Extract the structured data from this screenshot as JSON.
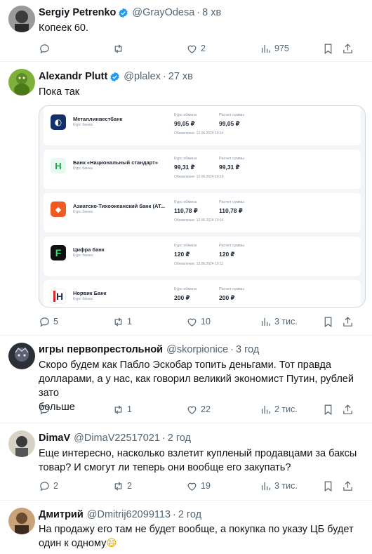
{
  "tweets": [
    {
      "name": "Sergiy Petrenko",
      "handle": "@GrayOdesa",
      "time": "8 хв",
      "text": "Копеек 60.",
      "replies": "",
      "retweets": "",
      "likes": "2",
      "views": "975"
    },
    {
      "name": "Alexandr Plutt",
      "handle": "@plalex",
      "time": "27 хв",
      "text": "Пока так",
      "replies": "5",
      "retweets": "1",
      "likes": "10",
      "views": "3 тис."
    },
    {
      "name": "игры первопрестольной",
      "handle": "@skorpionice",
      "time": "3 год",
      "text_line1": "Скоро будем как Пабло Эскобар топить деньгами. Тот правда",
      "text_line2": "долларами, а у нас, как говорил великий экономист Путин, рублей зато",
      "text_line3": "больше",
      "replies": "",
      "retweets": "1",
      "likes": "22",
      "views": "2 тис."
    },
    {
      "name": "DimaV",
      "handle": "@DimaV22517021",
      "time": "2 год",
      "text_line1": "Еще интересно, насколько взлетит купленый продавцами за баксы",
      "text_line2": "товар? И смогут ли теперь они вообще его закупать?",
      "replies": "2",
      "retweets": "2",
      "likes": "19",
      "views": "3 тис."
    },
    {
      "name": "Дмитрий",
      "handle": "@Dmitrij62099113",
      "time": "2 год",
      "text_line1": "На продажу его там не будет вообще, а покупка по указу ЦБ будет",
      "text_line2": "один к одному",
      "emoji": "😄"
    }
  ],
  "banks": [
    {
      "name": "Металлинвестбанк",
      "sub": "Курс банка",
      "l1": "Курс обмена",
      "v1": "99,05 ₽",
      "l2": "Расчет суммы",
      "v2": "99,05 ₽",
      "upd": "Обновление: 12.06.2024 19:14",
      "logo_color": "#12316b",
      "logo_char": "◐"
    },
    {
      "name": "Банк «Национальный стандарт»",
      "sub": "Курс банка",
      "l1": "Курс обмена",
      "v1": "99,31 ₽",
      "l2": "Расчет суммы",
      "v2": "99,31 ₽",
      "upd": "Обновление: 12.06.2024 19:16",
      "logo_color": "#e9f8ef",
      "logo_char": "H"
    },
    {
      "name": "Азиатско-Тихоокеанский банк (АТ...",
      "sub": "Курс банка",
      "l1": "Курс обмена",
      "v1": "110,78 ₽",
      "l2": "Расчет суммы",
      "v2": "110,78 ₽",
      "upd": "Обновление: 12.06.2024 19:14",
      "logo_color": "#f05a22",
      "logo_char": "◆"
    },
    {
      "name": "Цифра банк",
      "sub": "Курс банка",
      "l1": "Курс обмена",
      "v1": "120 ₽",
      "l2": "Расчет суммы",
      "v2": "120 ₽",
      "upd": "Обновление: 12.06.2024 19:11",
      "logo_color": "#111111",
      "logo_char": "F"
    },
    {
      "name": "Норвик Банк",
      "sub": "Курс банка",
      "l1": "Курс обмена",
      "v1": "200 ₽",
      "l2": "Расчет суммы",
      "v2": "200 ₽",
      "upd": "",
      "logo_color": "#ffffff",
      "logo_char": "H"
    }
  ]
}
